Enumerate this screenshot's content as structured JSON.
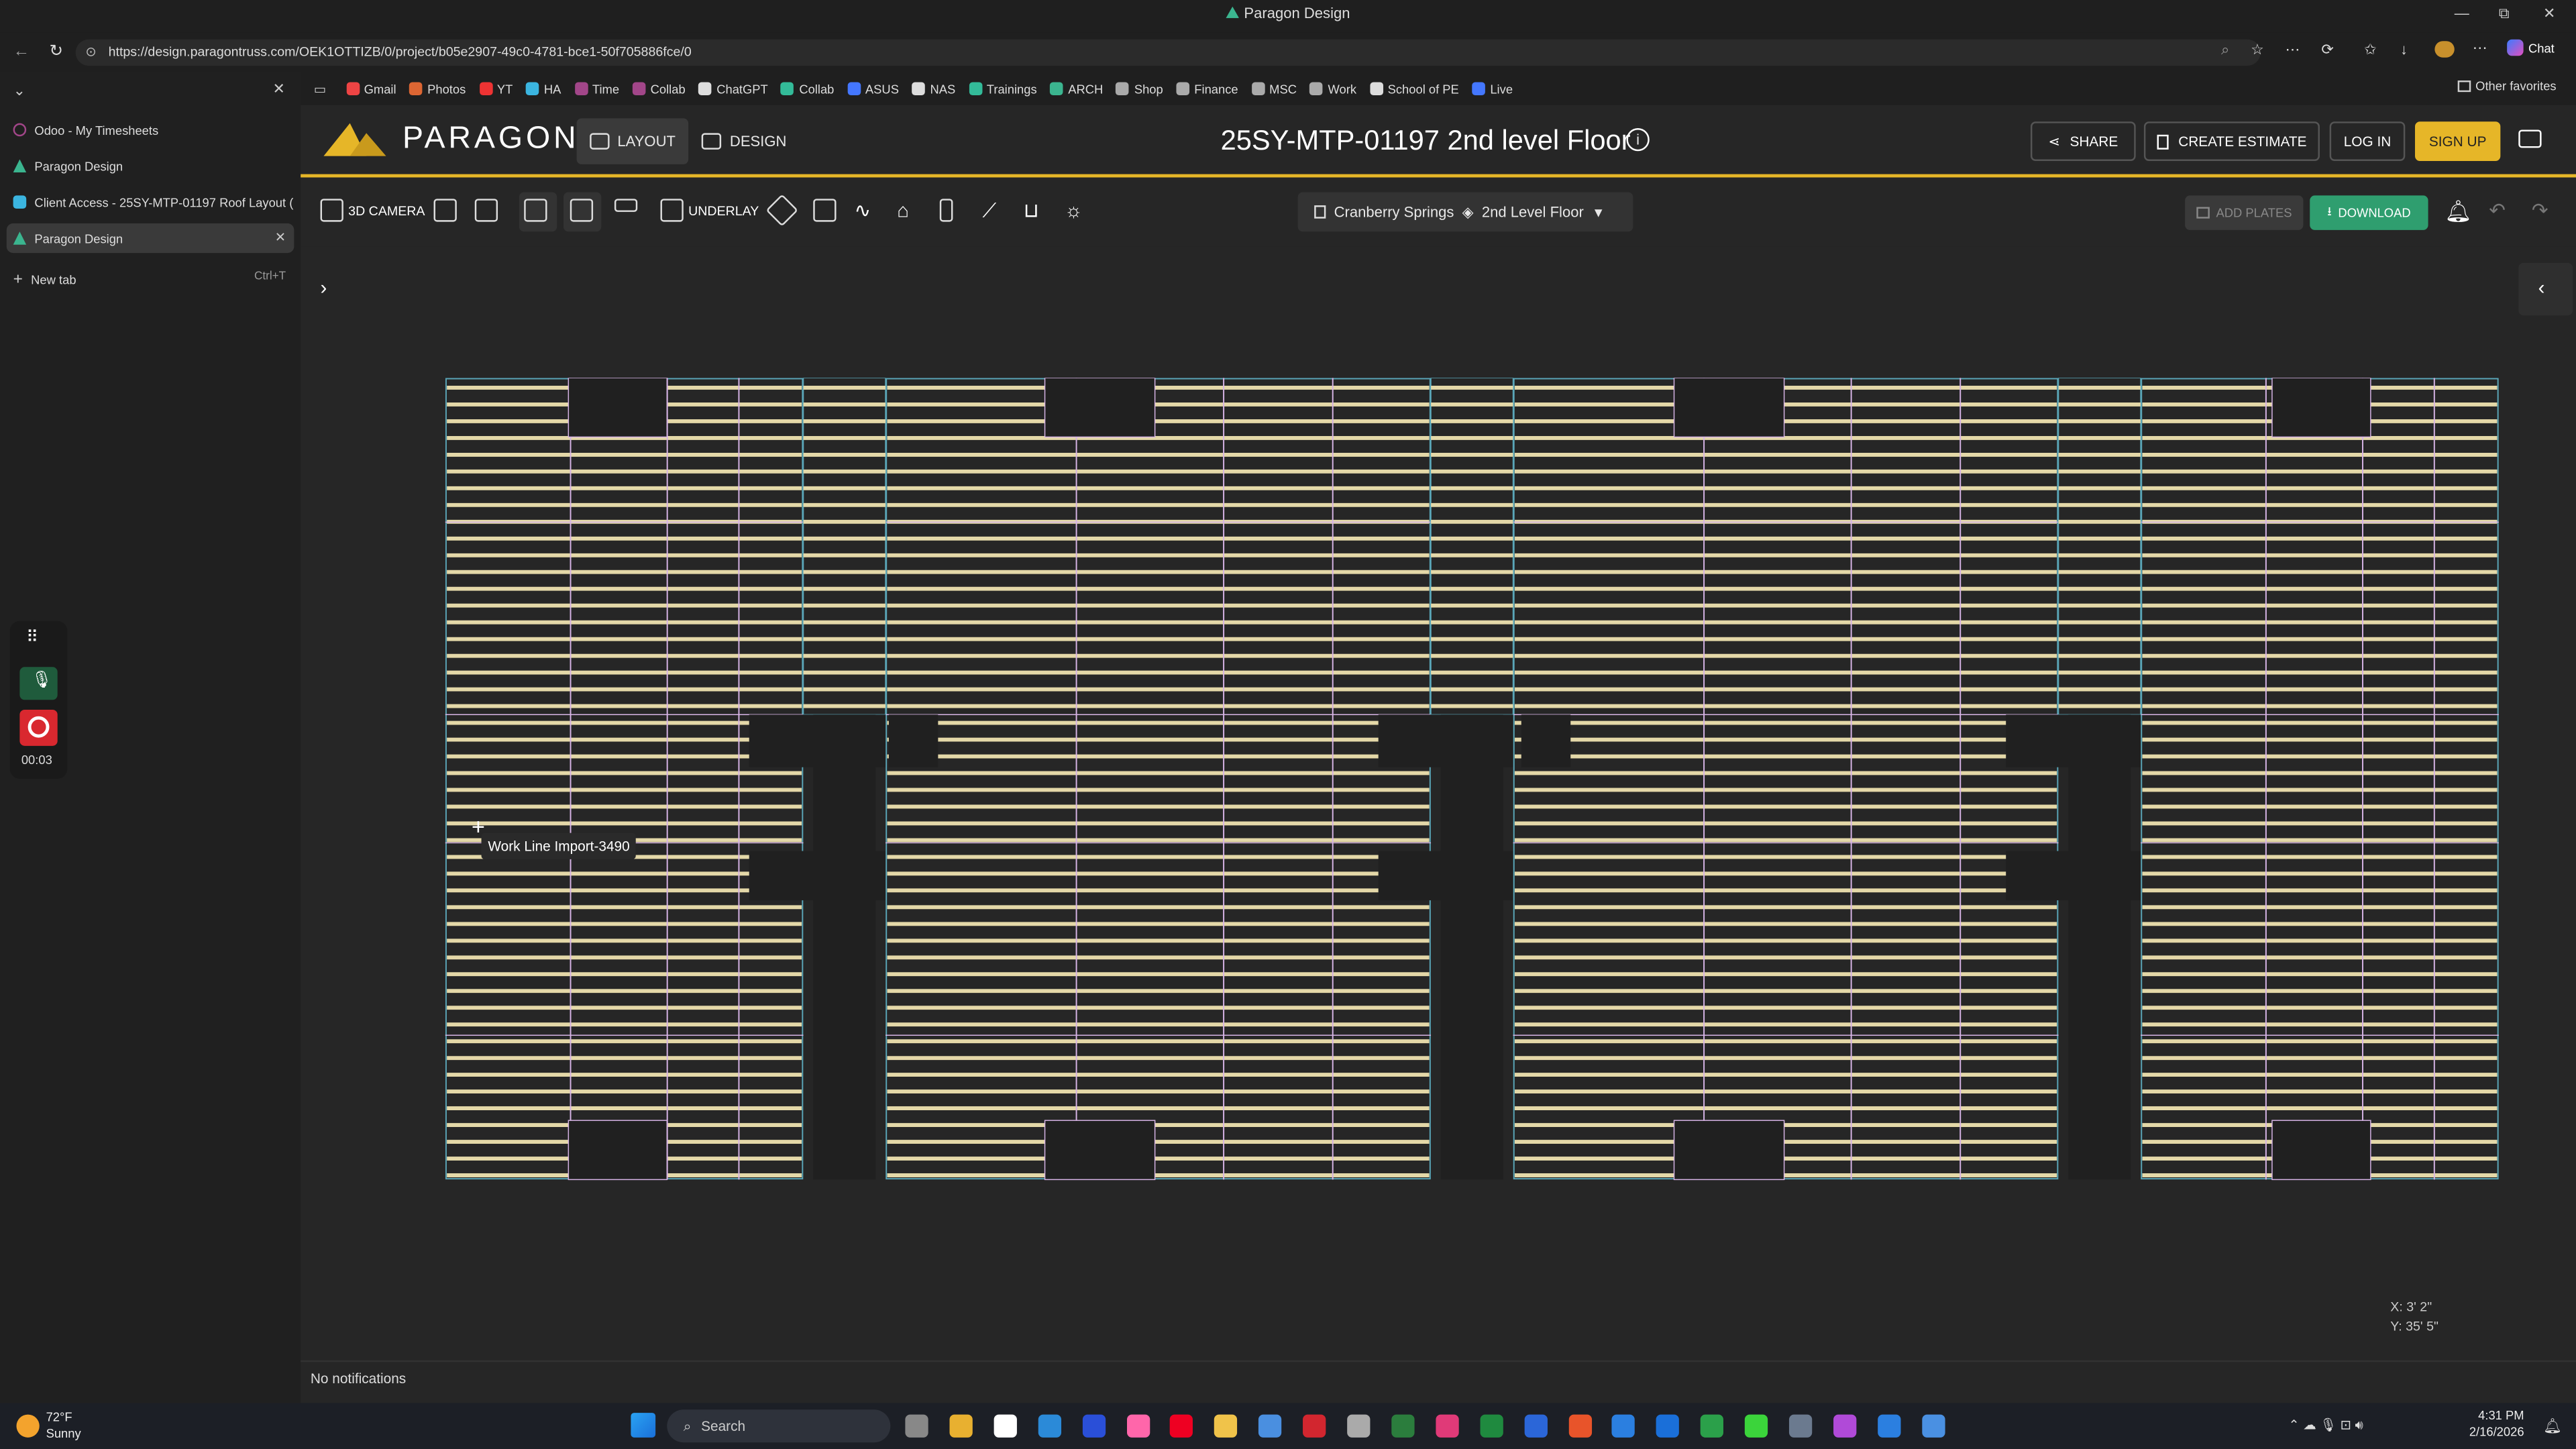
{
  "window": {
    "title": "Paragon Design",
    "minimize": "—",
    "restore": "⧉",
    "close": "✕"
  },
  "browser": {
    "url": "https://design.paragontruss.com/OEK1OTTIZB/0/project/b05e2907-49c0-4781-bce1-50f705886fce/0",
    "favorites": [
      "Gmail",
      "Photos",
      "YT",
      "HA",
      "Time",
      "Collab",
      "ChatGPT",
      "Collab",
      "ASUS",
      "NAS",
      "Trainings",
      "ARCH",
      "Shop",
      "Finance",
      "MSC",
      "Work",
      "School of PE",
      "Live"
    ],
    "other_favorites": "Other favorites",
    "chat_label": "Chat",
    "tabs": [
      {
        "label": "Odoo - My Timesheets",
        "color": "#a24689"
      },
      {
        "label": "Paragon Design",
        "color": "#3bb58f"
      },
      {
        "label": "Client Access - 25SY-MTP-01197 Roof Layout (",
        "color": "#3bb5e0"
      },
      {
        "label": "Paragon Design",
        "color": "#3bb58f",
        "active": true
      }
    ],
    "new_tab": "New tab",
    "new_tab_shortcut": "Ctrl+T"
  },
  "app": {
    "logo": "PARAGON",
    "mode_layout": "LAYOUT",
    "mode_design": "DESIGN",
    "project_title": "25SY-MTP-01197 2nd level Floor",
    "share": "SHARE",
    "create_estimate": "CREATE ESTIMATE",
    "login": "LOG IN",
    "signup": "SIGN UP",
    "accent": "#e6b628"
  },
  "toolbar": {
    "camera": "3D CAMERA",
    "underlay": "UNDERLAY",
    "project_name": "Cranberry Springs",
    "level": "2nd Level Floor",
    "add_plates": "ADD PLATES",
    "download": "DOWNLOAD"
  },
  "canvas": {
    "tooltip": "Work Line Import-3490",
    "coord_x": "X: 3' 2\"",
    "coord_y": "Y: 35' 5\""
  },
  "status": {
    "notifications": "No notifications"
  },
  "recorder": {
    "timer": "00:03"
  },
  "taskbar": {
    "temperature": "72°F",
    "weather": "Sunny",
    "search": "Search",
    "time": "4:31 PM",
    "date": "2/16/2026"
  }
}
